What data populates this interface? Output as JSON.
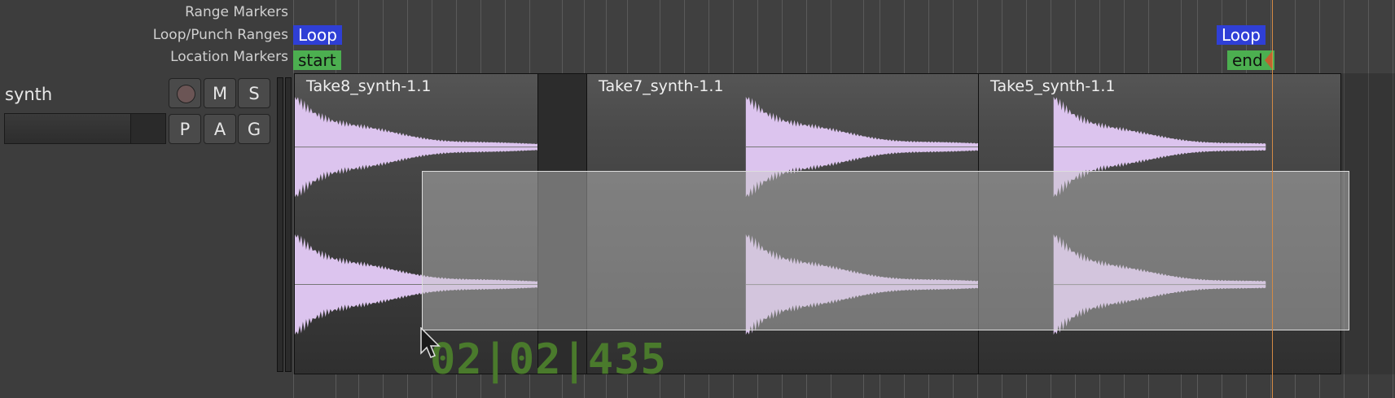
{
  "ruler": {
    "range_markers_label": "Range Markers",
    "loop_punch_label": "Loop/Punch Ranges",
    "location_markers_label": "Location Markers"
  },
  "markers": {
    "loop_start_label": "Loop",
    "loop_end_label": "Loop",
    "start_label": "start",
    "end_label": "end"
  },
  "track": {
    "name": "synth",
    "record_icon": "record-dot-icon",
    "mute_label": "M",
    "solo_label": "S",
    "playlist_label": "P",
    "automation_label": "A",
    "group_label": "G",
    "fader_level": 0.78
  },
  "regions": [
    {
      "name": "Take8_synth-1.1"
    },
    {
      "name": "Take7_synth-1.1"
    },
    {
      "name": "Take5_synth-1.1"
    }
  ],
  "timecode": "02|02|435",
  "colors": {
    "loop": "#2f3fd6",
    "location": "#4caf50",
    "waveform": "#dcc4ee",
    "timecode": "#4a7a2c",
    "playhead": "#d48a45"
  },
  "cursor_icon": "mouse-pointer-icon"
}
